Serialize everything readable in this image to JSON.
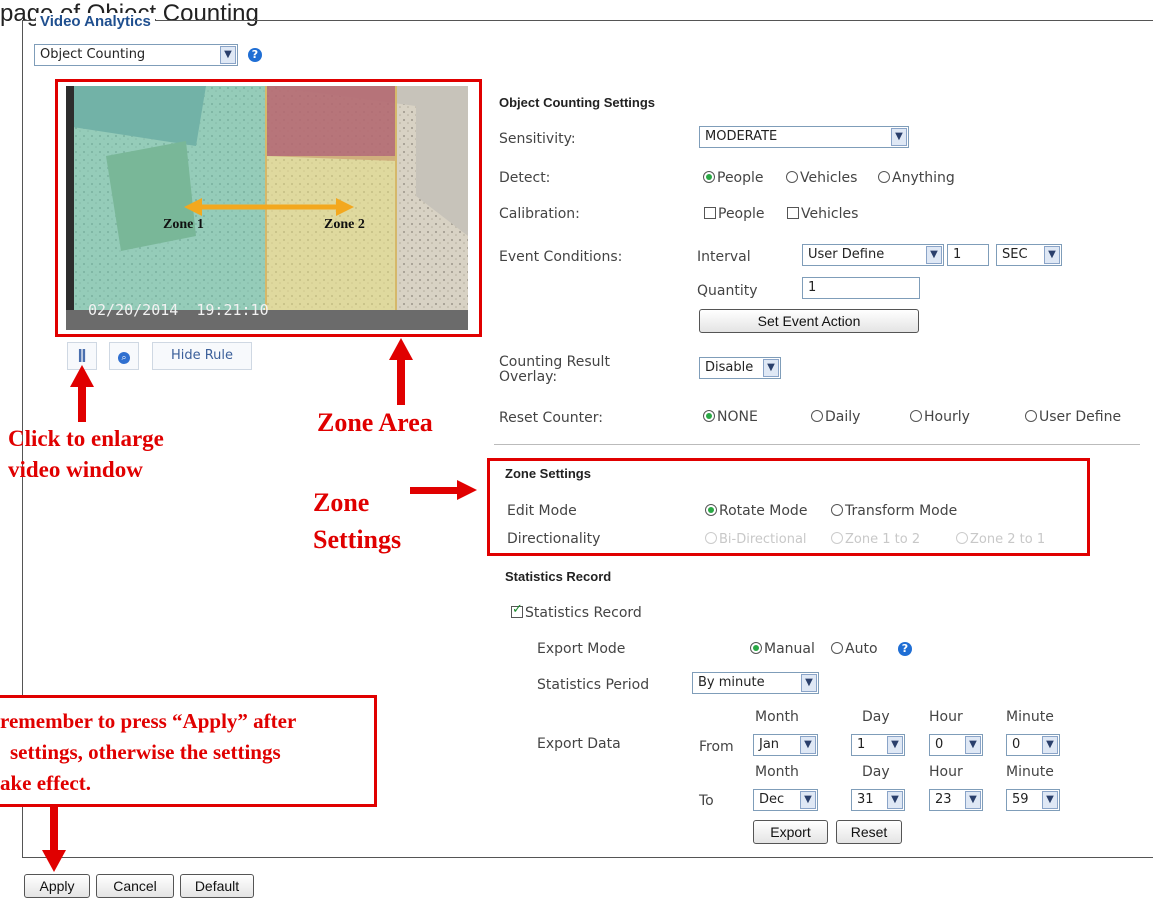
{
  "page": {
    "top_caption_fragment": "page of Object Counting",
    "section_legend": "Video Analytics",
    "mode_select": "Object Counting"
  },
  "video": {
    "timestamp": "02/20/2014  19:21:10",
    "zone1_label": "Zone 1",
    "zone2_label": "Zone 2",
    "hide_rule_label": "Hide Rule",
    "pause_icon": "pause-icon",
    "zoom_icon": "zoom-icon"
  },
  "settings": {
    "title": "Object Counting Settings",
    "sensitivity_label": "Sensitivity:",
    "sensitivity_value": "MODERATE",
    "detect_label": "Detect:",
    "detect_options": [
      "People",
      "Vehicles",
      "Anything"
    ],
    "calibration_label": "Calibration:",
    "calibration_options": [
      "People",
      "Vehicles"
    ],
    "event_conditions_label": "Event Conditions:",
    "interval_label": "Interval",
    "interval_mode": "User Define",
    "interval_value": "1",
    "interval_unit": "SEC",
    "quantity_label": "Quantity",
    "quantity_value": "1",
    "set_event_action": "Set Event Action",
    "overlay_label": "Counting Result Overlay:",
    "overlay_value": "Disable",
    "reset_label": "Reset Counter:",
    "reset_options": [
      "NONE",
      "Daily",
      "Hourly",
      "User Define"
    ]
  },
  "zone": {
    "title": "Zone Settings",
    "edit_mode_label": "Edit Mode",
    "edit_options": [
      "Rotate Mode",
      "Transform Mode"
    ],
    "directionality_label": "Directionality",
    "direction_options": [
      "Bi-Directional",
      "Zone 1 to 2",
      "Zone 2 to 1"
    ]
  },
  "stats": {
    "title": "Statistics Record",
    "checkbox_label": "Statistics Record",
    "export_mode_label": "Export Mode",
    "export_options": [
      "Manual",
      "Auto"
    ],
    "period_label": "Statistics Period",
    "period_value": "By minute",
    "export_data_label": "Export Data",
    "col_month": "Month",
    "col_day": "Day",
    "col_hour": "Hour",
    "col_minute": "Minute",
    "from_label": "From",
    "to_label": "To",
    "from_month": "Jan",
    "from_day": "1",
    "from_hour": "0",
    "from_minute": "0",
    "to_month": "Dec",
    "to_day": "31",
    "to_hour": "23",
    "to_minute": "59",
    "export_button": "Export",
    "reset_button": "Reset"
  },
  "footer": {
    "apply": "Apply",
    "cancel": "Cancel",
    "default": "Default"
  },
  "annotations": {
    "zone_area": "Zone Area",
    "enlarge_line1": "Click to enlarge",
    "enlarge_line2": "video window",
    "zone_settings_line1": "Zone",
    "zone_settings_line2": "Settings",
    "apply_note_line1": "remember to press “Apply” after",
    "apply_note_line2": "settings, otherwise the settings",
    "apply_note_line3": "ake effect."
  },
  "colors": {
    "annotation_red": "#e00000",
    "legend_blue": "#1f4f8f",
    "radio_green": "#2aa845"
  }
}
